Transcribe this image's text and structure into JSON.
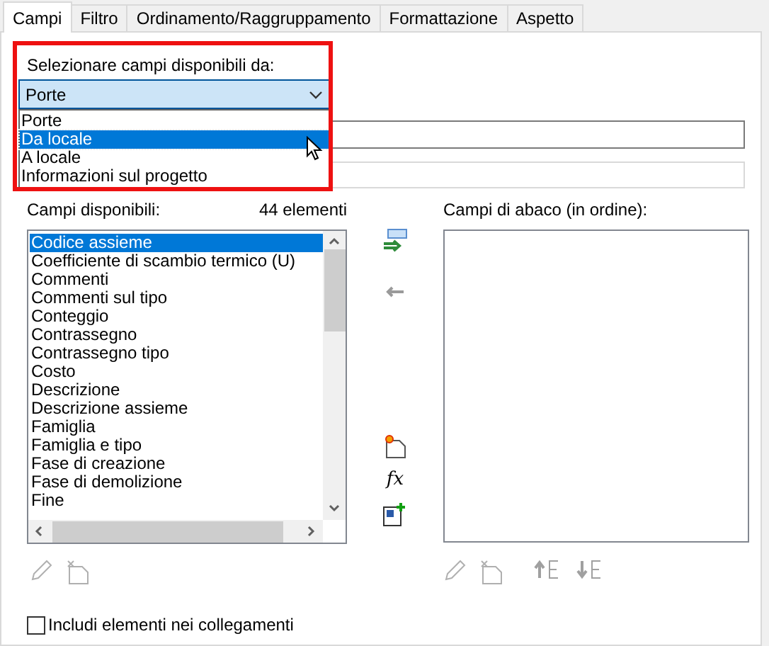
{
  "tabs": [
    {
      "label": "Campi",
      "selected": true
    },
    {
      "label": "Filtro",
      "selected": false
    },
    {
      "label": "Ordinamento/Raggruppamento",
      "selected": false
    },
    {
      "label": "Formattazione",
      "selected": false
    },
    {
      "label": "Aspetto",
      "selected": false
    }
  ],
  "source": {
    "label": "Selezionare campi disponibili da:",
    "value": "Porte",
    "expanded": true,
    "options": [
      {
        "label": "Porte",
        "highlighted": false
      },
      {
        "label": "Da locale",
        "highlighted": true
      },
      {
        "label": "A locale",
        "highlighted": false
      },
      {
        "label": "Informazioni sul progetto",
        "highlighted": false
      }
    ]
  },
  "available": {
    "label": "Campi disponibili:",
    "count": "44 elementi",
    "items": [
      {
        "label": "Codice assieme",
        "selected": true
      },
      {
        "label": "Coefficiente di scambio termico (U)",
        "selected": false
      },
      {
        "label": "Commenti",
        "selected": false
      },
      {
        "label": "Commenti sul tipo",
        "selected": false
      },
      {
        "label": "Conteggio",
        "selected": false
      },
      {
        "label": "Contrassegno",
        "selected": false
      },
      {
        "label": "Contrassegno tipo",
        "selected": false
      },
      {
        "label": "Costo",
        "selected": false
      },
      {
        "label": "Descrizione",
        "selected": false
      },
      {
        "label": "Descrizione assieme",
        "selected": false
      },
      {
        "label": "Famiglia",
        "selected": false
      },
      {
        "label": "Famiglia e tipo",
        "selected": false
      },
      {
        "label": "Fase di creazione",
        "selected": false
      },
      {
        "label": "Fase di demolizione",
        "selected": false
      },
      {
        "label": "Fine",
        "selected": false
      }
    ]
  },
  "formula_button": {
    "label": "fx"
  },
  "schedule": {
    "label": "Campi di abaco (in ordine):"
  },
  "include_links": {
    "label": "Includi elementi nei collegamenti",
    "checked": false
  }
}
